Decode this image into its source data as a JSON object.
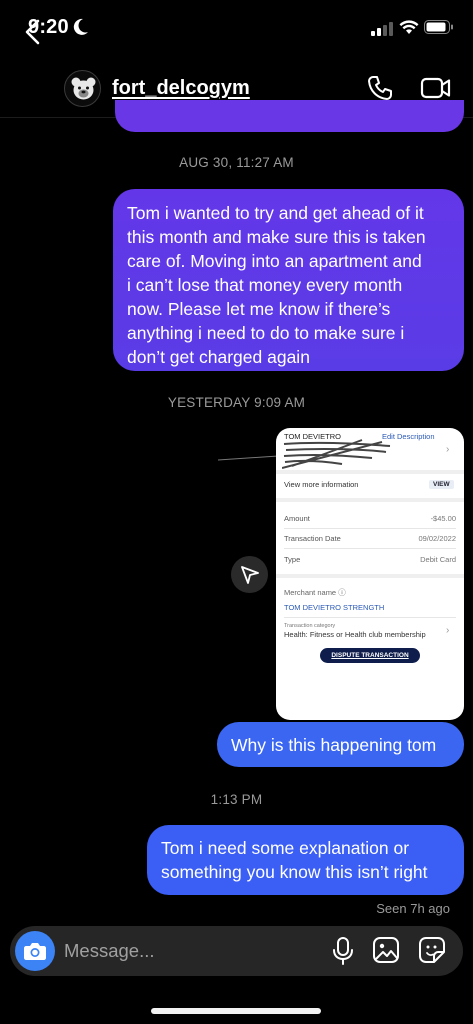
{
  "status_bar": {
    "time": "9:20"
  },
  "header": {
    "username": "fort_delcogym"
  },
  "messages": {
    "timestamp_1": "AUG 30, 11:27 AM",
    "bubble_1_lines": [
      "Tom i wanted to try and get ahead of it",
      "this month and make sure this is taken",
      "care of. Moving into an apartment and",
      "i can’t lose that money every month",
      "now. Please let me know if there’s",
      "anything i need to do to make sure i",
      "don’t get charged again"
    ],
    "timestamp_2": "YESTERDAY 9:09 AM",
    "bubble_2": "Why is this happening tom",
    "timestamp_3": "1:13 PM",
    "bubble_3_lines": [
      "Tom i need some explanation or",
      "something you know this isn’t right"
    ],
    "seen": "Seen 7h ago"
  },
  "receipt": {
    "name": "TOM DEVIETRO",
    "edit": "Edit Description",
    "view_more": "View more information",
    "view_button": "VIEW",
    "rows": [
      {
        "label": "Amount",
        "value": "-$45.00"
      },
      {
        "label": "Transaction Date",
        "value": "09/02/2022"
      },
      {
        "label": "Type",
        "value": "Debit Card"
      }
    ],
    "merchant_label": "Merchant name  ⓘ",
    "merchant": "TOM DEVIETRO STRENGTH",
    "category_label": "Transaction category",
    "category": "Health: Fitness or Health club membership",
    "dispute": "DISPUTE TRANSACTION"
  },
  "composer": {
    "placeholder": "Message..."
  },
  "icons": {
    "back": "chevron-left-icon",
    "phone": "phone-icon",
    "video": "video-camera-icon",
    "share": "send-icon",
    "camera": "camera-icon",
    "mic": "microphone-icon",
    "gallery": "gallery-icon",
    "sticker": "sticker-icon"
  },
  "colors": {
    "bubble_purple": "#6337e8",
    "bubble_blue": "#3a66f2",
    "camera_blue": "#3c83f6",
    "background": "#000000"
  }
}
